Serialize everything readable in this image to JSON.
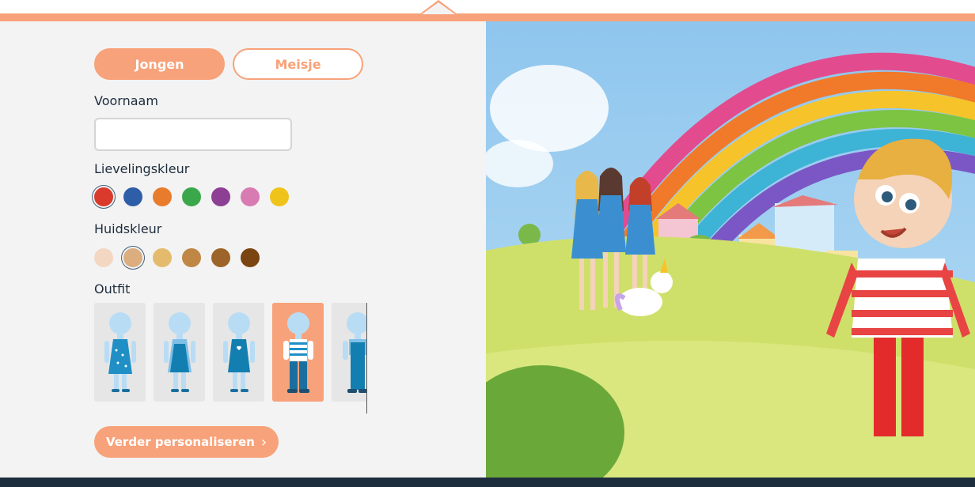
{
  "gender": {
    "boy_label": "Jongen",
    "girl_label": "Meisje",
    "selected": "Jongen"
  },
  "first_name": {
    "label": "Voornaam",
    "value": "",
    "placeholder": ""
  },
  "favorite_color": {
    "label": "Lievelingskleur",
    "options": [
      "#d93a2b",
      "#2f5ea8",
      "#e87c2c",
      "#3aa84a",
      "#8c3f93",
      "#d97bb3",
      "#f0c31b"
    ],
    "selected_index": 0
  },
  "skin_color": {
    "label": "Huidskleur",
    "options": [
      "#f3d7c3",
      "#dbad7f",
      "#e4bb6d",
      "#bf8645",
      "#9c6428",
      "#7a4510"
    ],
    "selected_index": 1
  },
  "outfit": {
    "label": "Outfit",
    "items": [
      "dress-dotted",
      "dress-apron",
      "dress-heart",
      "striped-shirt-jeans",
      "overall"
    ],
    "selected_index": 3
  },
  "cta": {
    "label": "Verder personaliseren"
  },
  "colors": {
    "accent": "#f7a27a",
    "text": "#1e2d3d",
    "footer": "#1e2d3d",
    "panel": "#f3f3f3"
  }
}
